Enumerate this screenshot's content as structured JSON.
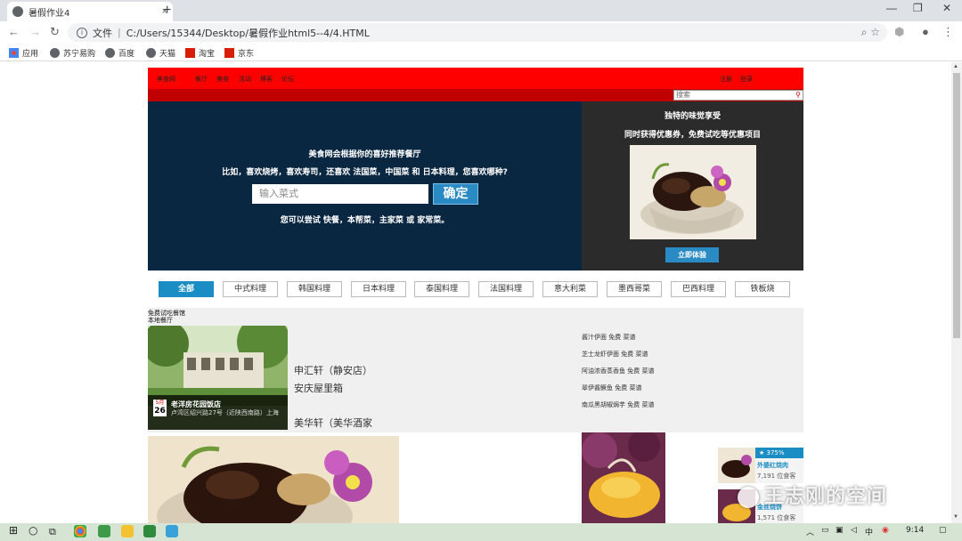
{
  "browser": {
    "tab_title": "暑假作业4",
    "new_tab": "+",
    "tab_close": "×",
    "window_controls": [
      "—",
      "❐",
      "✕"
    ],
    "url_prefix": "文件",
    "url": "C:/Users/15344/Desktop/暑假作业html5--4/4.HTML",
    "bookmarks": [
      {
        "label": "应用",
        "icon": "apps-icon",
        "color": "#e8453c"
      },
      {
        "label": "苏宁易购",
        "icon": "globe-icon",
        "color": "#5f6368"
      },
      {
        "label": "百度",
        "icon": "globe-icon",
        "color": "#5f6368"
      },
      {
        "label": "天猫",
        "icon": "globe-icon",
        "color": "#5f6368"
      },
      {
        "label": "淘宝",
        "icon": "taobao-icon",
        "color": "#d81e06"
      },
      {
        "label": "京东",
        "icon": "jd-icon",
        "color": "#d81e06"
      }
    ]
  },
  "site": {
    "topnav_left": [
      "美食网",
      "餐厅",
      "美食",
      "活动",
      "博客",
      "论坛"
    ],
    "topnav_right": [
      "注册",
      "登录"
    ],
    "search_placeholder": "搜索",
    "hero": {
      "line1": "美食网会根据你的喜好推荐餐厅",
      "line2": "比如，喜欢烧烤，喜欢寿司，还喜欢 法国菜，中国菜 和 日本料理，您喜欢哪种?",
      "input_placeholder": "输入菜式",
      "button": "确定",
      "line3": "您可以尝试 快餐，本帮菜，主家菜 或 家常菜。"
    },
    "promo": {
      "title": "独特的味觉享受",
      "subtitle": "同时获得优惠券，免费试吃等优惠项目",
      "cta": "立即体验"
    },
    "categories": [
      "全部",
      "中式料理",
      "韩国料理",
      "日本料理",
      "泰国料理",
      "法国料理",
      "意大利菜",
      "墨西哥菜",
      "巴西料理",
      "铁板烧"
    ],
    "section_labels": [
      "免费试吃餐馆",
      "本地餐厅"
    ],
    "featured": {
      "month": "5月",
      "day": "26",
      "name": "老洋房花园饭店",
      "address": "卢湾区绍兴路27号（近陕西南路）上海"
    },
    "restaurants": [
      "申汇轩（静安店）",
      "安庆屋里箱",
      "美华轩（美华酒家"
    ],
    "dishes": [
      "酱汁伊面 免费 菜谱",
      "芝士龙虾伊面 免费 菜谱",
      "阿油浓香蒸香鱼 免费 菜谱",
      "翠伊酱鳜鱼 免费 菜谱",
      "南瓜黑胡椒焗芋 免费 菜谱"
    ],
    "cards": [
      {
        "pct": "375%",
        "name": "外婆红烧肉",
        "count": "7,191 位食客"
      },
      {
        "pct": "",
        "name": "金丝烧饼",
        "count": "1,571 位食客"
      }
    ]
  },
  "watermark": "王志刚的空间",
  "taskbar": {
    "time": "9:14",
    "ime": "中"
  },
  "colors": {
    "nav_red": "#ff0000",
    "hero_navy": "#0a2742",
    "accent_blue": "#1a8dc4"
  }
}
